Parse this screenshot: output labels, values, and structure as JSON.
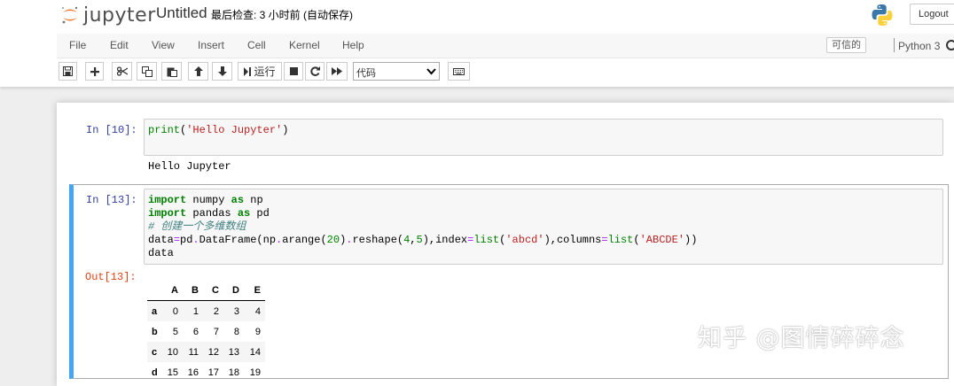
{
  "header": {
    "logo_text": "jupyter",
    "notebook_name": "Untitled",
    "checkpoint_status": "最后检查: 3 小时前  (自动保存)",
    "logout_label": "Logout"
  },
  "menubar": {
    "items": [
      "File",
      "Edit",
      "View",
      "Insert",
      "Cell",
      "Kernel",
      "Help"
    ],
    "trusted_label": "可信的",
    "kernel_name": "Python 3"
  },
  "toolbar": {
    "run_label": "运行",
    "cell_type": "代码",
    "buttons": [
      "save-icon",
      "plus-icon",
      "cut-icon",
      "copy-icon",
      "paste-icon",
      "arrow-up-icon",
      "arrow-down-icon",
      "run-icon",
      "stop-icon",
      "restart-icon",
      "fast-forward-icon",
      "keyboard-icon"
    ]
  },
  "cells": {
    "cell1": {
      "prompt": "In [10]:",
      "code": "print('Hello Jupyter')",
      "output": "Hello Jupyter"
    },
    "cell2": {
      "prompt": "In [13]:",
      "code_lines": [
        "import numpy as np",
        "import pandas as pd",
        "# 创建一个多维数组",
        "data=pd.DataFrame(np.arange(20).reshape(4,5),index=list('abcd'),columns=list('ABCDE'))",
        "data"
      ],
      "out_prompt": "Out[13]:",
      "table": {
        "columns": [
          "A",
          "B",
          "C",
          "D",
          "E"
        ],
        "rows": [
          {
            "index": "a",
            "values": [
              "0",
              "1",
              "2",
              "3",
              "4"
            ]
          },
          {
            "index": "b",
            "values": [
              "5",
              "6",
              "7",
              "8",
              "9"
            ]
          },
          {
            "index": "c",
            "values": [
              "10",
              "11",
              "12",
              "13",
              "14"
            ]
          },
          {
            "index": "d",
            "values": [
              "15",
              "16",
              "17",
              "18",
              "19"
            ]
          }
        ]
      }
    }
  },
  "watermark": "知乎 @图情碎碎念",
  "colors": {
    "selected_cell_border": "#42a5f5",
    "in_prompt": "#303f9f",
    "out_prompt": "#d84315",
    "keyword": "#008000",
    "string": "#ba2121"
  }
}
